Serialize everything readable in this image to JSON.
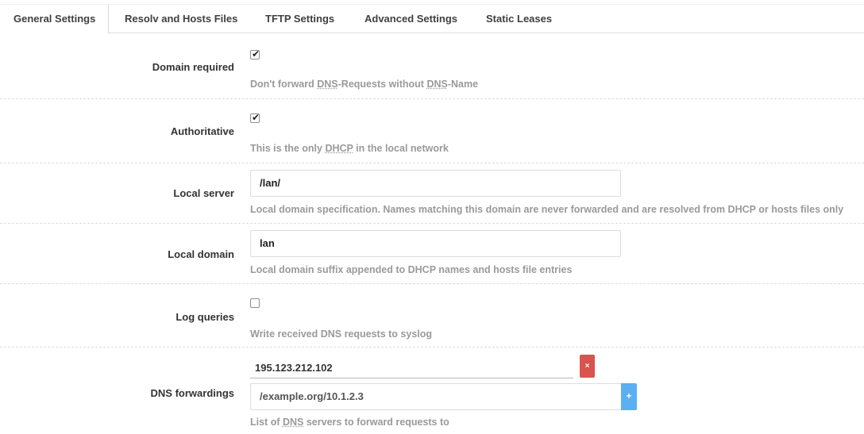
{
  "tabs": [
    {
      "label": "General Settings",
      "active": true
    },
    {
      "label": "Resolv and Hosts Files",
      "active": false
    },
    {
      "label": "TFTP Settings",
      "active": false
    },
    {
      "label": "Advanced Settings",
      "active": false
    },
    {
      "label": "Static Leases",
      "active": false
    }
  ],
  "domain_required": {
    "label": "Domain required",
    "checked": true,
    "desc": [
      "Don't forward ",
      "DNS",
      "-Requests without ",
      "DNS",
      "-Name"
    ]
  },
  "authoritative": {
    "label": "Authoritative",
    "checked": true,
    "desc": [
      "This is the only ",
      "DHCP",
      " in the local network"
    ]
  },
  "local_server": {
    "label": "Local server",
    "value": "/lan/",
    "desc": "Local domain specification. Names matching this domain are never forwarded and are resolved from DHCP or hosts files only"
  },
  "local_domain": {
    "label": "Local domain",
    "value": "lan",
    "desc": "Local domain suffix appended to DHCP names and hosts file entries"
  },
  "log_queries": {
    "label": "Log queries",
    "checked": false,
    "desc": "Write received DNS requests to syslog"
  },
  "dns_forwardings": {
    "label": "DNS forwardings",
    "entry": "195.123.212.102",
    "remove_symbol": "×",
    "new_entry_placeholder": "/example.org/10.1.2.3",
    "add_symbol": "+",
    "desc": [
      "List of ",
      "DNS",
      " servers to forward requests to"
    ]
  },
  "colors": {
    "remove_button": "#d9534f",
    "add_button": "#5bb0f2",
    "description_text": "#9a9a9a"
  }
}
